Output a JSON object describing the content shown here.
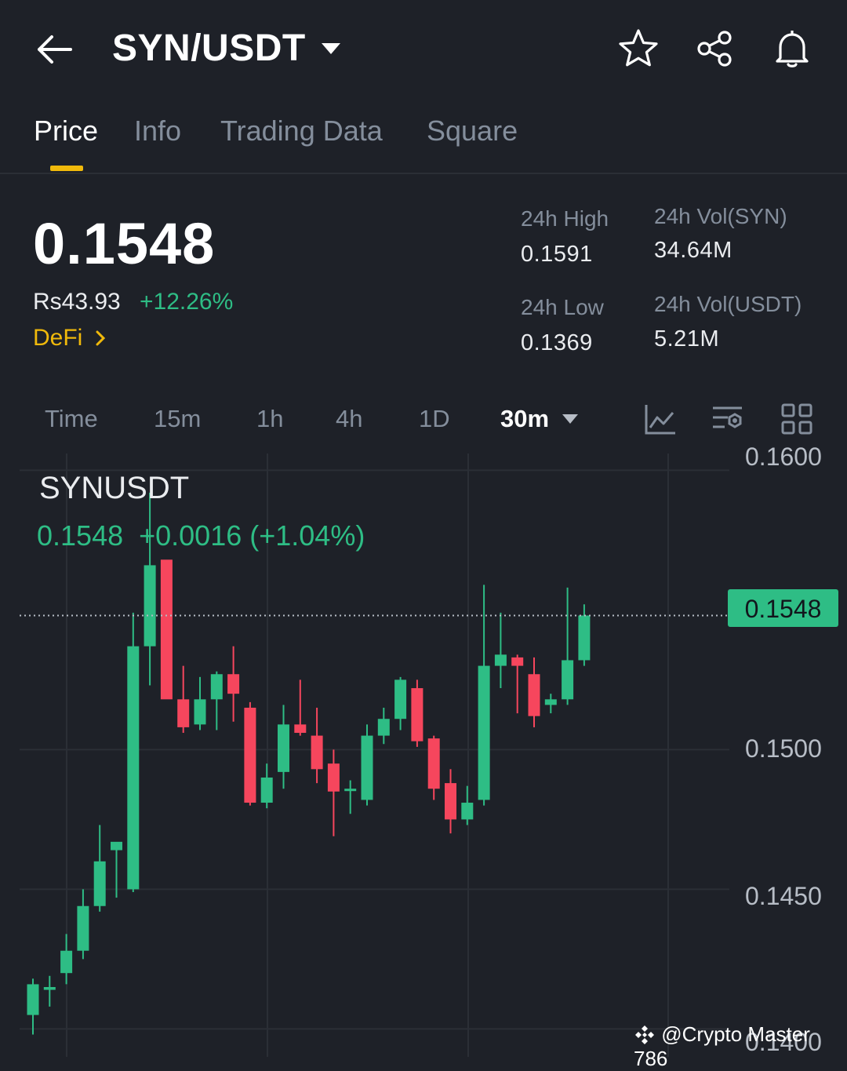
{
  "header": {
    "pair": "SYN/USDT",
    "icons": [
      "back-arrow-icon",
      "chevron-down-icon",
      "star-icon",
      "share-icon",
      "bell-icon"
    ]
  },
  "tabs": [
    {
      "label": "Price",
      "active": true
    },
    {
      "label": "Info",
      "active": false
    },
    {
      "label": "Trading Data",
      "active": false
    },
    {
      "label": "Square",
      "active": false
    }
  ],
  "price": {
    "last": "0.1548",
    "fiat": "Rs43.93",
    "change": "+12.26%",
    "tag": "DeFi"
  },
  "stats": {
    "high_label": "24h High",
    "high_value": "0.1591",
    "low_label": "24h Low",
    "low_value": "0.1369",
    "vol_base_label": "24h Vol(SYN)",
    "vol_base_value": "34.64M",
    "vol_quote_label": "24h Vol(USDT)",
    "vol_quote_value": "5.21M"
  },
  "intervals": [
    {
      "label": "Time",
      "active": false
    },
    {
      "label": "15m",
      "active": false
    },
    {
      "label": "1h",
      "active": false
    },
    {
      "label": "4h",
      "active": false
    },
    {
      "label": "1D",
      "active": false
    },
    {
      "label": "30m",
      "active": true
    }
  ],
  "tools": [
    "line-chart-icon",
    "indicator-settings-icon",
    "grid-layout-icon"
  ],
  "chart": {
    "symbol": "SYNUSDT",
    "ohlc_summary": "0.1548  +0.0016 (+1.04%)",
    "last_price_tag": "0.1548",
    "y_labels": [
      "0.1600",
      "0.1500",
      "0.1450",
      "0.1400"
    ]
  },
  "chart_data": {
    "type": "candlestick",
    "ylim": [
      0.139,
      0.1606
    ],
    "y_ticks": [
      0.16,
      0.15,
      0.145,
      0.14
    ],
    "last_price": 0.1548,
    "up_color": "#2ebd85",
    "down_color": "#f6465d",
    "candles": [
      {
        "o": 0.1405,
        "h": 0.1418,
        "l": 0.1398,
        "c": 0.1416
      },
      {
        "o": 0.1414,
        "h": 0.1419,
        "l": 0.1408,
        "c": 0.1415
      },
      {
        "o": 0.142,
        "h": 0.1434,
        "l": 0.1416,
        "c": 0.1428
      },
      {
        "o": 0.1428,
        "h": 0.145,
        "l": 0.1425,
        "c": 0.1444
      },
      {
        "o": 0.1444,
        "h": 0.1473,
        "l": 0.1442,
        "c": 0.146
      },
      {
        "o": 0.1464,
        "h": 0.1466,
        "l": 0.1447,
        "c": 0.1467
      },
      {
        "o": 0.145,
        "h": 0.1549,
        "l": 0.1449,
        "c": 0.1537
      },
      {
        "o": 0.1537,
        "h": 0.1592,
        "l": 0.1523,
        "c": 0.1566
      },
      {
        "o": 0.1568,
        "h": 0.1567,
        "l": 0.1522,
        "c": 0.1518
      },
      {
        "o": 0.1518,
        "h": 0.153,
        "l": 0.1506,
        "c": 0.1508
      },
      {
        "o": 0.1509,
        "h": 0.1526,
        "l": 0.1507,
        "c": 0.1518
      },
      {
        "o": 0.1518,
        "h": 0.1528,
        "l": 0.1507,
        "c": 0.1527
      },
      {
        "o": 0.1527,
        "h": 0.1537,
        "l": 0.151,
        "c": 0.152
      },
      {
        "o": 0.1515,
        "h": 0.1517,
        "l": 0.148,
        "c": 0.1481
      },
      {
        "o": 0.1481,
        "h": 0.1495,
        "l": 0.1479,
        "c": 0.149
      },
      {
        "o": 0.1492,
        "h": 0.1516,
        "l": 0.1486,
        "c": 0.1509
      },
      {
        "o": 0.1509,
        "h": 0.1525,
        "l": 0.1505,
        "c": 0.1506
      },
      {
        "o": 0.1505,
        "h": 0.1515,
        "l": 0.1488,
        "c": 0.1493
      },
      {
        "o": 0.1495,
        "h": 0.15,
        "l": 0.1469,
        "c": 0.1485
      },
      {
        "o": 0.1486,
        "h": 0.1489,
        "l": 0.1477,
        "c": 0.1486
      },
      {
        "o": 0.1482,
        "h": 0.1509,
        "l": 0.148,
        "c": 0.1505
      },
      {
        "o": 0.1505,
        "h": 0.1515,
        "l": 0.1502,
        "c": 0.1511
      },
      {
        "o": 0.1511,
        "h": 0.1526,
        "l": 0.1507,
        "c": 0.1525
      },
      {
        "o": 0.1522,
        "h": 0.1525,
        "l": 0.1501,
        "c": 0.1503
      },
      {
        "o": 0.1504,
        "h": 0.1505,
        "l": 0.1482,
        "c": 0.1486
      },
      {
        "o": 0.1488,
        "h": 0.1493,
        "l": 0.147,
        "c": 0.1475
      },
      {
        "o": 0.1475,
        "h": 0.1487,
        "l": 0.1473,
        "c": 0.1481
      },
      {
        "o": 0.1482,
        "h": 0.1559,
        "l": 0.148,
        "c": 0.153
      },
      {
        "o": 0.153,
        "h": 0.1549,
        "l": 0.1522,
        "c": 0.1534
      },
      {
        "o": 0.1533,
        "h": 0.1534,
        "l": 0.1513,
        "c": 0.153
      },
      {
        "o": 0.1527,
        "h": 0.1533,
        "l": 0.1508,
        "c": 0.1512
      },
      {
        "o": 0.1516,
        "h": 0.152,
        "l": 0.1513,
        "c": 0.1518
      },
      {
        "o": 0.1518,
        "h": 0.1558,
        "l": 0.1516,
        "c": 0.1532
      },
      {
        "o": 0.1532,
        "h": 0.1552,
        "l": 0.153,
        "c": 0.1548
      }
    ]
  },
  "watermark": "@Crypto Master 786"
}
